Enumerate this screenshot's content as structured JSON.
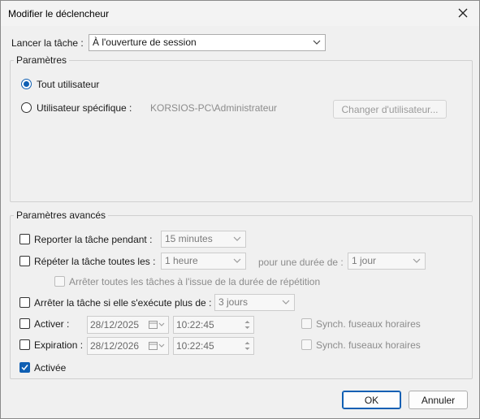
{
  "window": {
    "title": "Modifier le déclencheur"
  },
  "launch": {
    "label": "Lancer la tâche :",
    "value": "À l'ouverture de session"
  },
  "settings": {
    "legend": "Paramètres",
    "all_users_label": "Tout utilisateur",
    "specific_user_label": "Utilisateur spécifique :",
    "user_name": "KORSIOS-PC\\Administrateur",
    "change_user_button": "Changer d'utilisateur..."
  },
  "advanced": {
    "legend": "Paramètres avancés",
    "delay_label": "Reporter la tâche pendant :",
    "delay_value": "15 minutes",
    "repeat_label": "Répéter la tâche toutes les :",
    "repeat_value": "1 heure",
    "duration_label": "pour une durée de :",
    "duration_value": "1 jour",
    "stop_all_label": "Arrêter toutes les tâches à l'issue de la durée de répétition",
    "stop_if_label": "Arrêter la tâche si elle s'exécute plus de :",
    "stop_if_value": "3 jours",
    "activate_label": "Activer :",
    "activate_date": "28/12/2025",
    "activate_time": "10:22:45",
    "activate_sync_label": "Synch. fuseaux horaires",
    "expire_label": "Expiration :",
    "expire_date": "28/12/2026",
    "expire_time": "10:22:45",
    "expire_sync_label": "Synch. fuseaux horaires",
    "enabled_label": "Activée"
  },
  "footer": {
    "ok_label": "OK",
    "cancel_label": "Annuler"
  },
  "colors": {
    "accent": "#0f5fb3",
    "background": "#f0f0f0"
  },
  "icons": [
    "close-icon",
    "chevron-down-icon",
    "calendar-icon",
    "spin-up-icon",
    "spin-down-icon",
    "checkmark-icon"
  ]
}
